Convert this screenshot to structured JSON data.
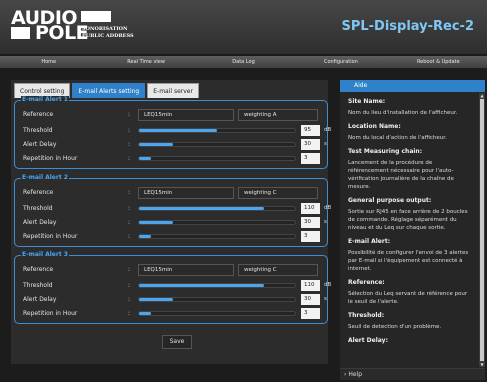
{
  "brand": {
    "word1": "AUDIO",
    "word2": "POLE",
    "tag1": "SONORISATION",
    "tag2": "PUBLIC ADDRESS"
  },
  "device_title": "SPL-Display-Rec-2",
  "nav": [
    "Home",
    "Real Time view",
    "Data Log",
    "Configuration",
    "Reboot & Update"
  ],
  "tabs": [
    "Control setting",
    "E-mail Alerts setting",
    "E-mail server"
  ],
  "active_tab": 1,
  "field_labels": {
    "reference": "Reference",
    "threshold": "Threshold",
    "delay": "Alert Delay",
    "repetition": "Repetition in Hour",
    "colon": ":"
  },
  "alerts": [
    {
      "title": "E-mail Alert 1",
      "reference": "LEQ15min",
      "weighting": "weighting A",
      "threshold": "95",
      "threshold_unit": "dB",
      "threshold_level": 0.5,
      "delay": "30",
      "delay_unit": "s",
      "delay_level": 0.22,
      "repetition": "3",
      "repetition_level": 0.08
    },
    {
      "title": "E-mail Alert 2",
      "reference": "LEQ15min",
      "weighting": "weighting C",
      "threshold": "110",
      "threshold_unit": "dB",
      "threshold_level": 0.8,
      "delay": "30",
      "delay_unit": "s",
      "delay_level": 0.22,
      "repetition": "3",
      "repetition_level": 0.08
    },
    {
      "title": "E-mail Alert 3",
      "reference": "LEQ15min",
      "weighting": "weighting C",
      "threshold": "110",
      "threshold_unit": "dB",
      "threshold_level": 0.8,
      "delay": "30",
      "delay_unit": "s",
      "delay_level": 0.22,
      "repetition": "3",
      "repetition_level": 0.08
    }
  ],
  "save_label": "Save",
  "aide": {
    "title": "Aide",
    "sections": [
      {
        "heading": "Site Name:",
        "text": "Nom du lieu d'installation de l'afficheur."
      },
      {
        "heading": "Location Name:",
        "text": "Nom du local d'action de l'afficheur."
      },
      {
        "heading": "Test Measuring chain:",
        "text": "Lancement de la procédure de référencement nécessaire pour l'auto-vérification journalière de la chaîne de mesure."
      },
      {
        "heading": "General purpose output:",
        "text": "Sortie sur RJ45 en face arrière de 2 boucles de commande. Réglage séparément du niveau et du Leq sur chaque sortie."
      },
      {
        "heading": "E-mail Alert:",
        "text": "Possibilité de configurer l'envoi de 3 alertes par E-mail si l'équipement est connecté à internet."
      },
      {
        "heading": "Reference:",
        "text": "Sélection du Leq servant de référence pour le seuil de l'alerte."
      },
      {
        "heading": "Threshold:",
        "text": "Seuil de detection d'un problème."
      },
      {
        "heading": "Alert Delay:",
        "text": ""
      }
    ]
  },
  "help_label": "Help",
  "colors": {
    "accent": "#2f82c9",
    "title_blue": "#7ec8f4",
    "slider": "#4aa6f0"
  },
  "icons": {
    "scroll_up": "triangle-up",
    "scroll_down": "triangle-down",
    "help_toggle": "chevron-right"
  }
}
